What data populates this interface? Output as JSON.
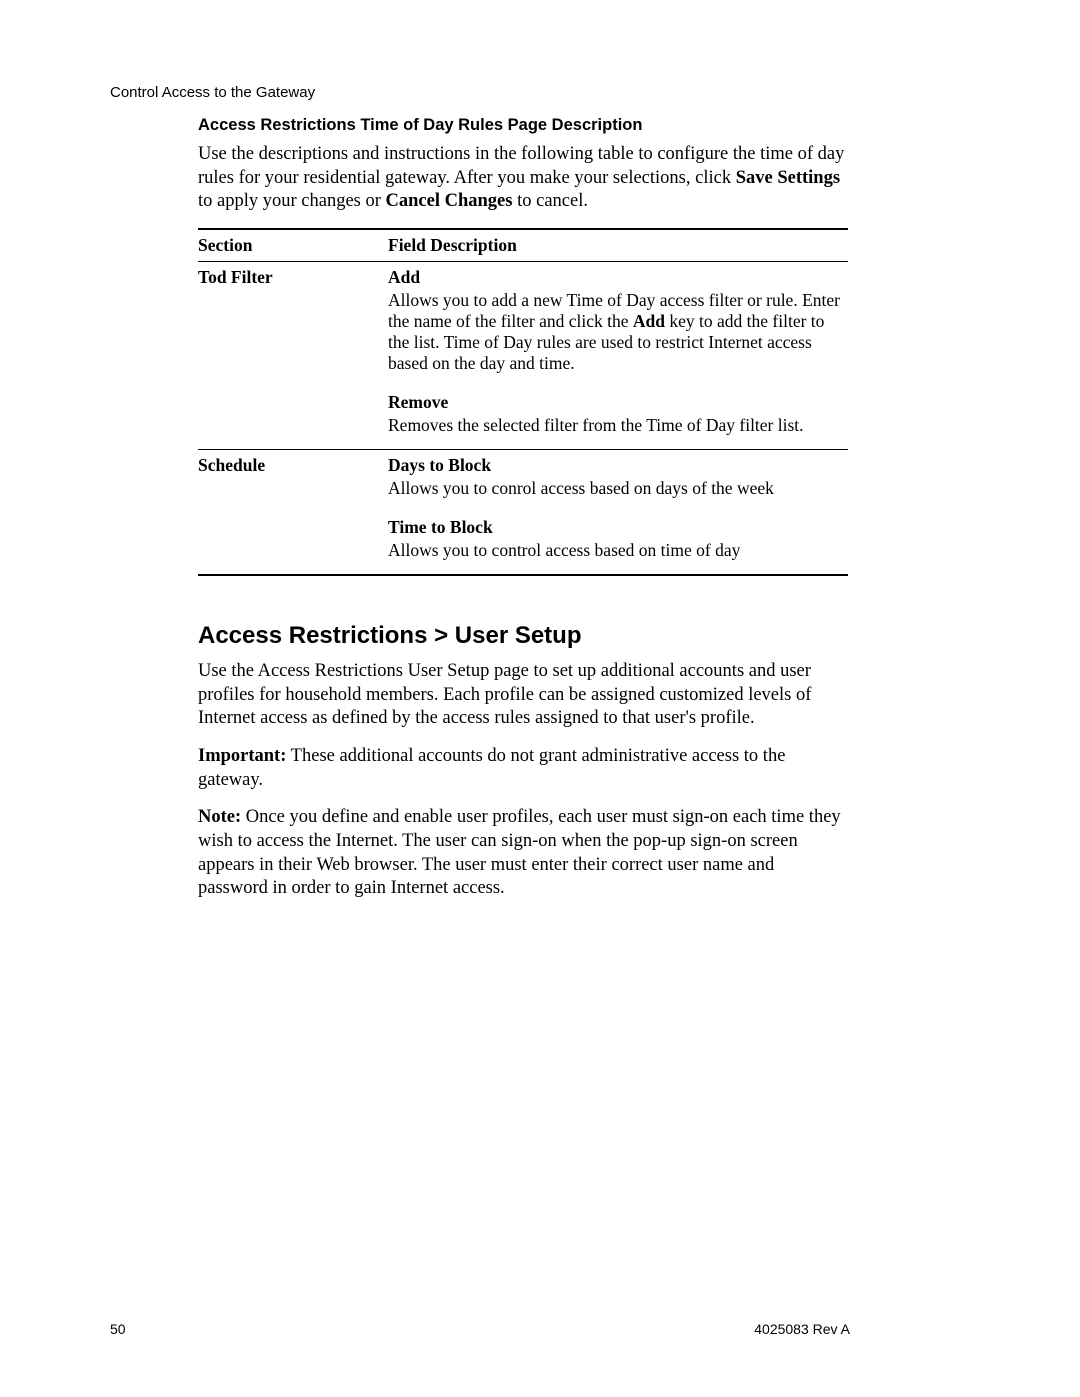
{
  "runningHead": "Control Access to the Gateway",
  "section1": {
    "title": "Access Restrictions Time of Day Rules Page Description",
    "intro_a": "Use the descriptions and instructions in the following table to configure the time of day rules for your residential gateway. After you make your selections, click ",
    "intro_b": "Save Settings",
    "intro_c": " to apply your changes or ",
    "intro_d": "Cancel Changes",
    "intro_e": " to cancel."
  },
  "table": {
    "head_section": "Section",
    "head_field": "Field Description",
    "rows": [
      {
        "section": "Tod Filter",
        "fields": [
          {
            "label": "Add",
            "body_a": "Allows you to add a new Time of Day access filter or rule. Enter the name of the filter and click the ",
            "body_b": "Add",
            "body_c": " key to add the filter to the list. Time of Day rules are used to restrict Internet access based on the day and time."
          },
          {
            "label": "Remove",
            "body": "Removes the selected filter from the Time of Day filter list."
          }
        ]
      },
      {
        "section": "Schedule",
        "fields": [
          {
            "label": "Days to Block",
            "body": "Allows you to conrol access based on days of the week"
          },
          {
            "label": "Time to Block",
            "body": "Allows you to control access based on time of day"
          }
        ]
      }
    ]
  },
  "section2": {
    "title": "Access Restrictions > User Setup",
    "p1": "Use the Access Restrictions User Setup page to set up additional accounts and user profiles for household members. Each profile can be assigned customized levels of Internet access as defined by the access rules assigned to that user's profile.",
    "imp_label": "Important:",
    "imp_body": " These additional accounts do not grant administrative access to the gateway.",
    "note_label": "Note:",
    "note_body": " Once you define and enable user profiles, each user must sign-on each time they wish to access the Internet. The user can sign-on when the pop-up sign-on screen appears in their Web browser. The user must enter their correct user name and password in order to gain Internet access."
  },
  "footer": {
    "pageNumber": "50",
    "docRef": "4025083 Rev A"
  }
}
